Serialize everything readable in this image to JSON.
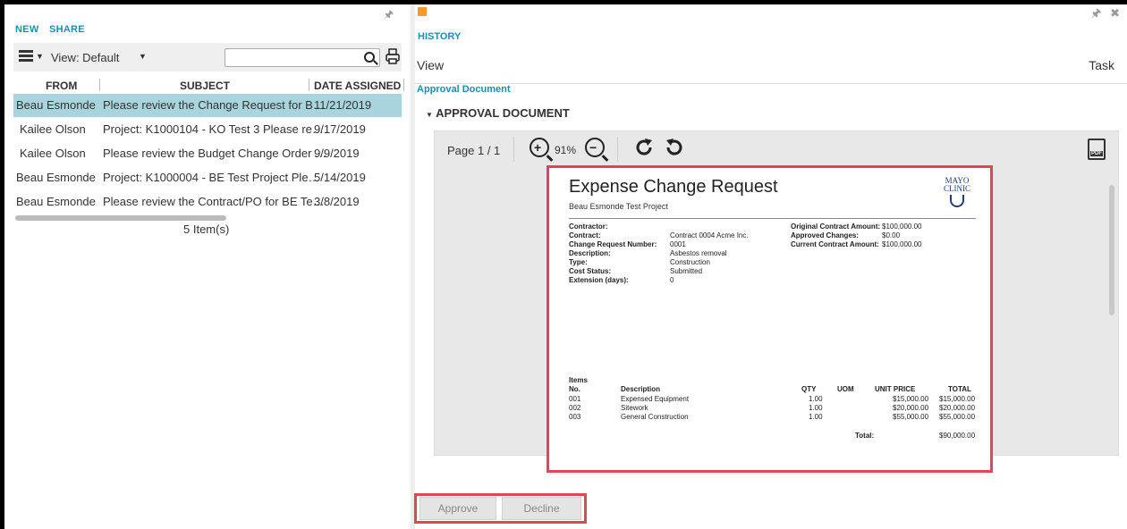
{
  "left_pane": {
    "actions": [
      "NEW",
      "SHARE"
    ],
    "view_label": "View: Default",
    "search_value": "",
    "columns": [
      "FROM",
      "SUBJECT",
      "DATE ASSIGNED"
    ],
    "rows": [
      {
        "from": "Beau Esmonde",
        "subject": "Please review the Change Request for B…",
        "date": "11/21/2019",
        "selected": true
      },
      {
        "from": "Kailee Olson",
        "subject": "Project: K1000104 - KO Test 3  Please re…",
        "date": "9/17/2019",
        "selected": false
      },
      {
        "from": "Kailee Olson",
        "subject": "Please review the Budget Change Order …",
        "date": "9/9/2019",
        "selected": false
      },
      {
        "from": "Beau Esmonde",
        "subject": "Project: K1000004 - BE Test Project  Ple…",
        "date": "5/14/2019",
        "selected": false
      },
      {
        "from": "Beau Esmonde",
        "subject": "Please review the Contract/PO for BE Te…",
        "date": "3/8/2019",
        "selected": false
      }
    ],
    "item_count": "5 Item(s)"
  },
  "right_pane": {
    "history_label": "HISTORY",
    "view_label": "View",
    "task_label": "Task",
    "approval_link": "Approval Document",
    "section_title": "APPROVAL DOCUMENT",
    "viewer": {
      "page_label": "Page 1 / 1",
      "zoom": "91%"
    },
    "document": {
      "title": "Expense Change Request",
      "subtitle": "Beau Esmonde Test Project",
      "logo_line1": "MAYO",
      "logo_line2": "CLINIC",
      "fields_left": [
        {
          "label": "Contractor:",
          "value": ""
        },
        {
          "label": "Contract:",
          "value": "Contract 0004 Acme Inc."
        },
        {
          "label": "Change Request Number:",
          "value": "0001"
        },
        {
          "label": "Description:",
          "value": "Asbestos removal"
        },
        {
          "label": "Type:",
          "value": "Construction"
        },
        {
          "label": "Cost Status:",
          "value": "Submitted"
        },
        {
          "label": "Extension (days):",
          "value": "0"
        }
      ],
      "fields_right": [
        {
          "label": "Original Contract Amount:",
          "value": "$100,000.00"
        },
        {
          "label": "Approved Changes:",
          "value": "$0.00"
        },
        {
          "label": "Current Contract Amount:",
          "value": "$100,000.00"
        }
      ],
      "items_heading": "Items",
      "item_columns": [
        "No.",
        "Description",
        "QTY",
        "UOM",
        "UNIT PRICE",
        "TOTAL"
      ],
      "items": [
        {
          "no": "001",
          "description": "Expensed Equipment",
          "qty": "1.00",
          "uom": "",
          "unit_price": "$15,000.00",
          "total": "$15,000.00"
        },
        {
          "no": "002",
          "description": "Sitework",
          "qty": "1.00",
          "uom": "",
          "unit_price": "$20,000.00",
          "total": "$20,000.00"
        },
        {
          "no": "003",
          "description": "General Construction",
          "qty": "1.00",
          "uom": "",
          "unit_price": "$55,000.00",
          "total": "$55,000.00"
        }
      ],
      "total_label": "Total:",
      "total_value": "$90,000.00"
    },
    "buttons": {
      "approve": "Approve",
      "decline": "Decline"
    }
  },
  "colors": {
    "accent": "#1a8fb0",
    "selected_row": "#a8d4de",
    "highlight": "#e0474f",
    "status_square": "#f59a2a"
  }
}
